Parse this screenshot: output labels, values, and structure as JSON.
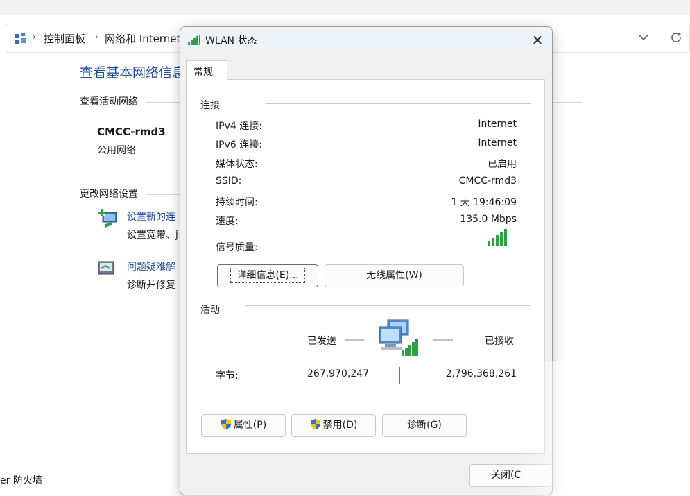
{
  "address_bar": {
    "crumbs": [
      "控制面板",
      "网络和 Internet"
    ],
    "icons": [
      "control-panel-icon",
      "chevron-down-icon",
      "refresh-icon"
    ]
  },
  "background": {
    "title": "查看基本网络信息",
    "active_networks_label": "查看活动网络",
    "network_name": "CMCC-rmd3",
    "network_type": "公用网络",
    "change_settings_label": "更改网络设置",
    "task1_link": "设置新的连",
    "task1_desc": "设置宽带、j",
    "task2_link": "问题疑难解",
    "task2_desc": "诊断并修复",
    "firewall_link": "er 防火墙"
  },
  "dialog": {
    "title": "WLAN 状态",
    "tab": "常规",
    "connection": {
      "label": "连接",
      "rows": [
        {
          "label": "IPv4 连接:",
          "value": "Internet"
        },
        {
          "label": "IPv6 连接:",
          "value": "Internet"
        },
        {
          "label": "媒体状态:",
          "value": "已启用"
        },
        {
          "label": "SSID:",
          "value": "CMCC-rmd3"
        },
        {
          "label": "持续时间:",
          "value": "1 天 19:46:09"
        },
        {
          "label": "速度:",
          "value": "135.0 Mbps"
        }
      ],
      "signal_label": "信号质量:",
      "signal_bars": 5
    },
    "buttons": {
      "details": "详细信息(E)...",
      "wireless": "无线属性(W)",
      "properties": "属性(P)",
      "disable": "禁用(D)",
      "diagnose": "诊断(G)",
      "close": "关闭(C"
    },
    "activity": {
      "label": "活动",
      "sent": "已发送",
      "received": "已接收",
      "bytes_label": "字节:",
      "bytes_sent": "267,970,247",
      "bytes_received": "2,796,368,261"
    }
  }
}
